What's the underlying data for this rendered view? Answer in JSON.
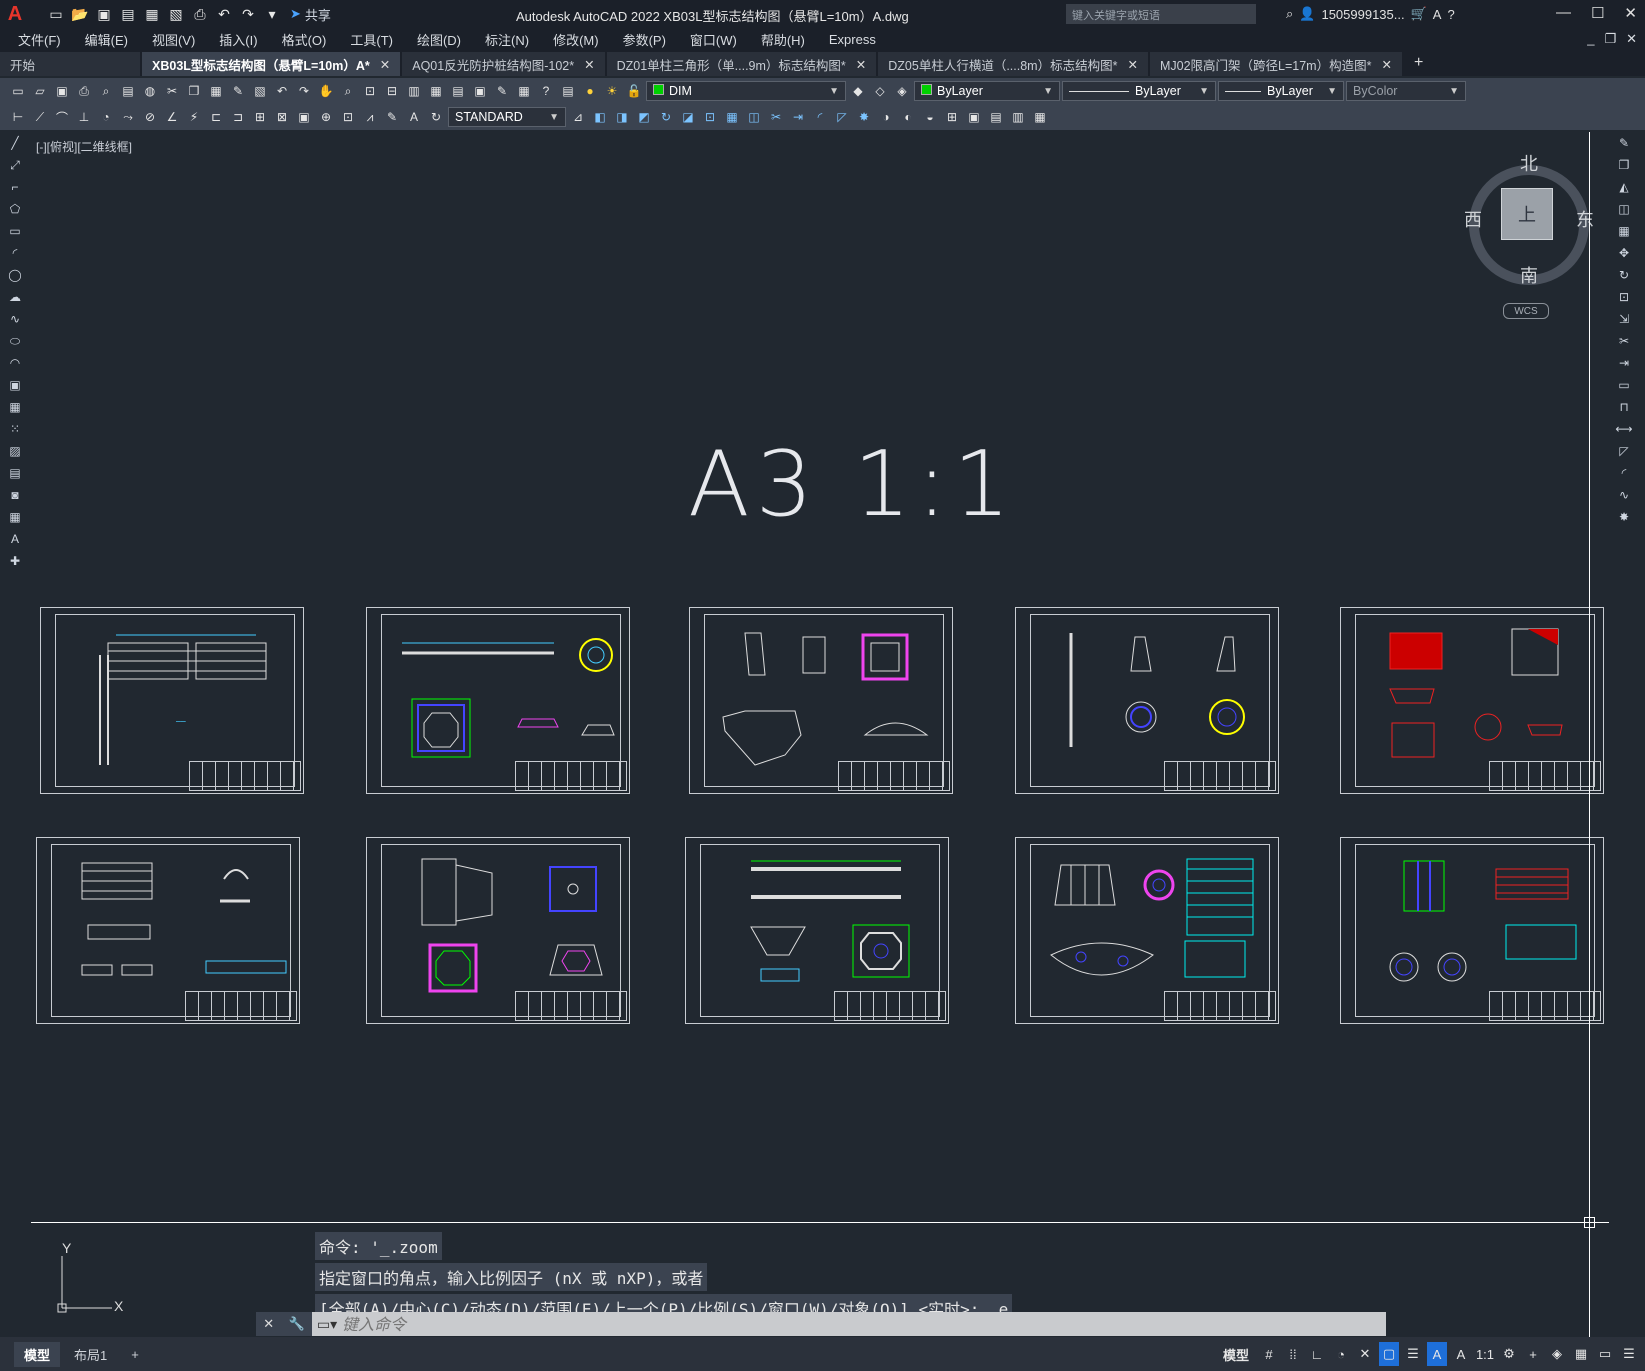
{
  "app": {
    "title": "Autodesk AutoCAD 2022    XB03L型标志结构图（悬臂L=10m）A.dwg",
    "share_label": "共享",
    "search_placeholder": "键入关键字或短语",
    "user": "1505999135...",
    "logo": "A"
  },
  "menu": {
    "items": [
      "文件(F)",
      "编辑(E)",
      "视图(V)",
      "插入(I)",
      "格式(O)",
      "工具(T)",
      "绘图(D)",
      "标注(N)",
      "修改(M)",
      "参数(P)",
      "窗口(W)",
      "帮助(H)",
      "Express"
    ]
  },
  "tabs": [
    {
      "label": "开始"
    },
    {
      "label": "XB03L型标志结构图（悬臂L=10m）A*"
    },
    {
      "label": "AQ01反光防护桩结构图-102*"
    },
    {
      "label": "DZ01单柱三角形（单....9m）标志结构图*"
    },
    {
      "label": "DZ05单柱人行横道（....8m）标志结构图*"
    },
    {
      "label": "MJ02限高门架（跨径L=17m）构造图*"
    }
  ],
  "toolbar": {
    "layer": "DIM",
    "color": "ByLayer",
    "linetype": "ByLayer",
    "lineweight": "ByLayer",
    "plotstyle": "ByColor",
    "textstyle": "STANDARD"
  },
  "viewport": {
    "label": "[-][俯视][二维线框]",
    "big_title": "A3 1:1"
  },
  "viewcube": {
    "top": "上",
    "north": "北",
    "south": "南",
    "west": "西",
    "east": "东",
    "wcs": "WCS"
  },
  "ucs": {
    "x": "X",
    "y": "Y"
  },
  "command": {
    "history": [
      "命令: '_.zoom",
      "指定窗口的角点，输入比例因子 (nX 或 nXP)，或者",
      "[全部(A)/中心(C)/动态(D)/范围(E)/上一个(P)/比例(S)/窗口(W)/对象(O)] <实时>: _e"
    ],
    "placeholder": "键入命令"
  },
  "status": {
    "layouts": [
      "模型",
      "布局1"
    ],
    "model_label": "模型",
    "scale": "1:1"
  },
  "colors": {
    "accent": "#1e6fd9",
    "background": "#212830",
    "cyan": "#00e0e0",
    "magenta": "#e040e0",
    "red": "#e02020",
    "green": "#40e040",
    "blue": "#4060ff",
    "yellow": "#f0f040"
  }
}
